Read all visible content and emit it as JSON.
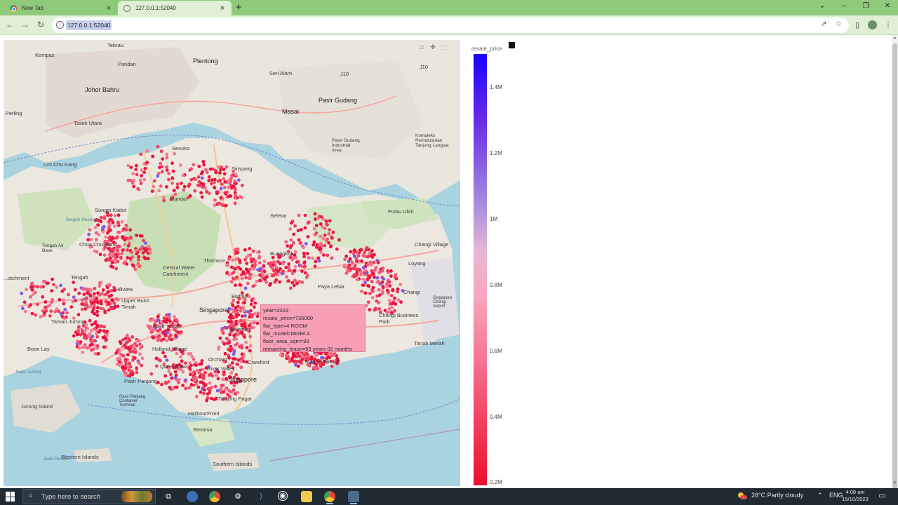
{
  "browser": {
    "tabs": [
      {
        "label": "New Tab",
        "active": false,
        "icon": "chrome-icon"
      },
      {
        "label": "127.0.0.1:52040",
        "active": true,
        "icon": "globe-icon"
      }
    ],
    "new_tab_symbol": "+",
    "url": "127.0.0.1:52040",
    "window_controls": {
      "collapse": "⌄",
      "minimize": "–",
      "restore": "❐",
      "close": "✕"
    }
  },
  "map": {
    "labels": {
      "tebrau": "Tebrau",
      "kempas": "Kempas",
      "pandan": "Pandan",
      "plentong": "Plentong",
      "sri_alam": "Seri Alam",
      "johor_bahru": "Johor Bahru",
      "masai": "Masai",
      "pasir_gudang": "Pasir Gudang",
      "perling": "Perling",
      "tasek_utara": "Tasek Utara",
      "pasir_gudang_industrial": "Pasir Gudang Industrial Area",
      "kompleks": "Kompleks Perindustrian Tanjung Langsat",
      "senoko": "Senoko",
      "simpang": "Simpang",
      "lim_chu_kang": "Lim Chu Kang",
      "mandai": "Mandai",
      "sungei_kadut": "Sungei Kadut",
      "seletar": "Seletar",
      "pulau_ubin": "Pulau Ubin",
      "tengah_reserve": "Tengah Reserve",
      "choa_chu_kang": "Choa Chu Kang",
      "tengah_air_base": "Tengah Air Base",
      "central_water_catchment": "Central Water Catchment",
      "thomson": "Thomson",
      "buangkok": "Buangkok",
      "changi_village": "Changi Village",
      "loyang": "Loyang",
      "tengah": "Tengah",
      "hillview": "Hillview",
      "upper_bukit_timah": "Upper Bukit Timah",
      "bishan": "Bishan",
      "paya_lebar": "Paya Lebar",
      "changi": "Changi",
      "changi_airport": "Singapore Changi Airport",
      "intersection": "...stchment",
      "tamanjurong": "Taman Jurong",
      "bukit_timah": "Bukit Timah",
      "singapore_north": "Singapore",
      "balestier": "Balestier",
      "changi_business_park": "Changi Business Park",
      "tanah_merah": "Tanah Merah",
      "boon_lay": "Boon Lay",
      "holland_village": "Holland Village",
      "queenstown": "Queenstown",
      "orchard": "Orchard",
      "river_valley": "River Valley",
      "marine_terrace": "Marine Terrace",
      "crawford": "Crawford",
      "selat_jurong": "Selat Jurong",
      "pasir_panjang": "Pasir Panjang",
      "pasir_panjang_container": "Pasir Panjang Container Terminal",
      "singapore_city": "Singapore",
      "tanjong_pagar": "Tanjong Pagar",
      "jurong_island": "Jurong Island",
      "harbourfront": "HarbourFront",
      "sentosa": "Sentosa",
      "western_islands": "Western Islands",
      "southern_islands": "Southern Islands",
      "selat_pandan": "Selat Pandan",
      "j10": "J10",
      "j10b": "J10"
    }
  },
  "tooltip": {
    "year": "year=2023",
    "resale_price": "resale_price=735000",
    "flat_type": "flat_type=4 ROOM",
    "flat_model": "flat_model=Model A",
    "floor_area": "floor_area_sqm=93",
    "remaining_lease": "remaining_lease=93 years 02 months"
  },
  "colorbar": {
    "title": "resale_price",
    "ticks": [
      "1.4M",
      "1.2M",
      "1M",
      "0.8M",
      "0.6M",
      "0.4M",
      "0.2M"
    ],
    "colors": {
      "high": "#1a00ff",
      "mid": "#f7a6bd",
      "low": "#eb0f2e"
    }
  },
  "taskbar": {
    "search_placeholder": "Type here to search",
    "weather": "28°C  Partly cloudy",
    "language": "ENG",
    "time": "4:08 am",
    "date": "15/10/2023",
    "tray_chevron": "⌃",
    "apps": [
      "task-view-icon",
      "app-icon",
      "chrome-icon",
      "settings-icon",
      "vscode-icon",
      "github-icon",
      "file-explorer-icon",
      "chrome-active-icon",
      "app2-icon"
    ]
  }
}
